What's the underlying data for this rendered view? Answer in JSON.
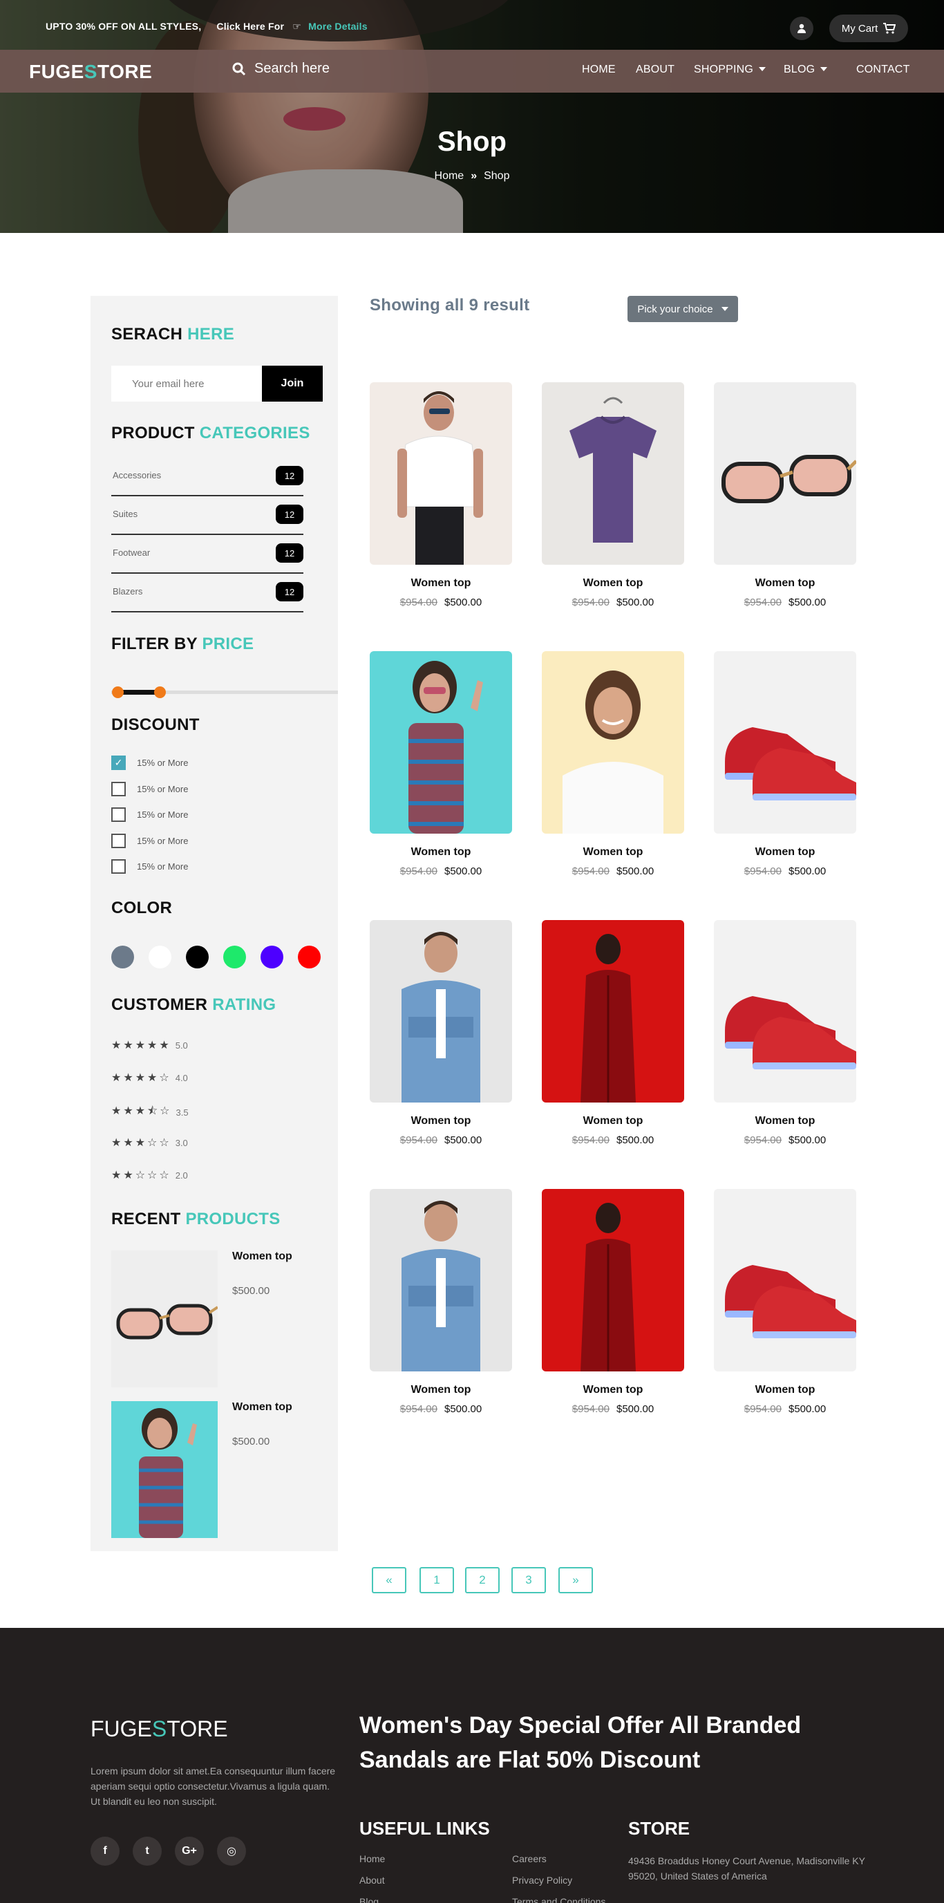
{
  "promo": {
    "text": "UPTO 30% OFF ON ALL STYLES,",
    "cta": "Click Here For",
    "link": "More Details"
  },
  "cart": {
    "label": "My Cart"
  },
  "brand": {
    "logo_a": "FUGE",
    "logo_s": "S",
    "logo_b": "TORE"
  },
  "search": {
    "label": "Search here"
  },
  "nav": {
    "home": "HOME",
    "about": "ABOUT",
    "shopping": "SHOPPING",
    "blog": "BLOG",
    "contact": "CONTACT"
  },
  "hero": {
    "title": "Shop",
    "crumb_home": "Home",
    "crumb_current": "Shop"
  },
  "sidebar": {
    "search_title": "SERACH",
    "search_accent": "HERE",
    "email_placeholder": "Your email here",
    "join": "Join",
    "categories_title": "PRODUCT",
    "categories_accent": "CATEGORIES",
    "categories": [
      {
        "label": "Accessories",
        "count": "12"
      },
      {
        "label": "Suites",
        "count": "12"
      },
      {
        "label": "Footwear",
        "count": "12"
      },
      {
        "label": "Blazers",
        "count": "12"
      }
    ],
    "price_title": "FILTER BY",
    "price_accent": "PRICE",
    "discount_title": "DISCOUNT",
    "discounts": [
      {
        "label": "15% or More",
        "checked": true
      },
      {
        "label": "15% or More",
        "checked": false
      },
      {
        "label": "15% or More",
        "checked": false
      },
      {
        "label": "15% or More",
        "checked": false
      },
      {
        "label": "15% or More",
        "checked": false
      }
    ],
    "color_title": "COLOR",
    "colors": [
      "#6c7a8a",
      "#ffffff",
      "#000000",
      "#1ee96b",
      "#4d00ff",
      "#ff0000"
    ],
    "rating_title": "CUSTOMER",
    "rating_accent": "RATING",
    "ratings": [
      {
        "stars": "★★★★★",
        "value": "5.0"
      },
      {
        "stars": "★★★★☆",
        "value": "4.0"
      },
      {
        "stars": "★★★⯪☆",
        "value": "3.5"
      },
      {
        "stars": "★★★☆☆",
        "value": "3.0"
      },
      {
        "stars": "★★☆☆☆",
        "value": "2.0"
      }
    ],
    "recent_title": "RECENT",
    "recent_accent": "PRODUCTS",
    "recent": [
      {
        "name": "Women top",
        "price": "$500.00",
        "image": "sunglasses"
      },
      {
        "name": "Women top",
        "price": "$500.00",
        "image": "woman-patterned-dress"
      }
    ]
  },
  "results": {
    "showing": "Showing all 9 result",
    "sort": "Pick your choice"
  },
  "products": [
    {
      "name": "Women top",
      "old_price": "$954.00",
      "price": "$500.00",
      "image": "man-white-tshirt"
    },
    {
      "name": "Women top",
      "old_price": "$954.00",
      "price": "$500.00",
      "image": "purple-tshirt"
    },
    {
      "name": "Women top",
      "old_price": "$954.00",
      "price": "$500.00",
      "image": "sunglasses"
    },
    {
      "name": "Women top",
      "old_price": "$954.00",
      "price": "$500.00",
      "image": "woman-patterned-dress"
    },
    {
      "name": "Women top",
      "old_price": "$954.00",
      "price": "$500.00",
      "image": "woman-white-tshirt"
    },
    {
      "name": "Women top",
      "old_price": "$954.00",
      "price": "$500.00",
      "image": "red-sneakers"
    },
    {
      "name": "Women top",
      "old_price": "$954.00",
      "price": "$500.00",
      "image": "man-denim-shirt"
    },
    {
      "name": "Women top",
      "old_price": "$954.00",
      "price": "$500.00",
      "image": "red-suit"
    },
    {
      "name": "Women top",
      "old_price": "$954.00",
      "price": "$500.00",
      "image": "red-sneakers"
    },
    {
      "name": "Women top",
      "old_price": "$954.00",
      "price": "$500.00",
      "image": "man-denim-shirt"
    },
    {
      "name": "Women top",
      "old_price": "$954.00",
      "price": "$500.00",
      "image": "red-suit"
    },
    {
      "name": "Women top",
      "old_price": "$954.00",
      "price": "$500.00",
      "image": "red-sneakers"
    }
  ],
  "pagination": {
    "prev": "«",
    "pages": [
      "1",
      "2",
      "3"
    ],
    "next": "»"
  },
  "footer": {
    "logo_a": "FUGE",
    "logo_s": "S",
    "logo_b": "TORE",
    "about": "Lorem ipsum dolor sit amet.Ea consequuntur illum facere aperiam sequi optio consectetur.Vivamus a ligula quam. Ut blandit eu leo non suscipit.",
    "social": [
      {
        "icon": "facebook-icon",
        "glyph": "f"
      },
      {
        "icon": "twitter-icon",
        "glyph": "t"
      },
      {
        "icon": "google-plus-icon",
        "glyph": "G+"
      },
      {
        "icon": "instagram-icon",
        "glyph": "◎"
      }
    ],
    "offer": "Women's Day Special Offer All Branded Sandals are Flat 50% Discount",
    "useful_title": "USEFUL LINKS",
    "links_a": [
      "Home",
      "About",
      "Blog"
    ],
    "links_b": [
      "Careers",
      "Privacy Policy",
      "Terms and Conditions"
    ],
    "store_title": "STORE",
    "store_address": "49436 Broaddus Honey Court Avenue, Madisonville KY 95020, United States of America"
  }
}
